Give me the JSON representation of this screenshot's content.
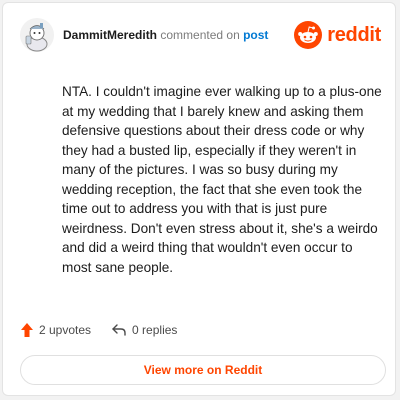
{
  "header": {
    "username": "DammitMeredith",
    "action_text": "commented on",
    "link_text": "post"
  },
  "logo": {
    "wordmark": "reddit",
    "icon": "reddit-snoo-icon",
    "color": "#ff4500"
  },
  "comment": {
    "text": "NTA. I couldn't imagine ever walking up to a plus-one at my wedding that I barely knew and asking them defensive questions about their dress code or why they had a busted lip, especially if they weren't in many of the pictures. I was so busy during my wedding reception, the fact that she even took the time out to address you with that is just pure weirdness. Don't even stress about it, she's a weirdo and did a weird thing that wouldn't even occur to most sane people."
  },
  "actions": {
    "upvotes": "2 upvotes",
    "upvote_icon": "upvote-arrow-icon",
    "replies": "0 replies",
    "reply_icon": "reply-arrow-icon"
  },
  "footer": {
    "view_more": "View more on Reddit"
  },
  "colors": {
    "accent": "#ff4500",
    "link": "#0079d3"
  }
}
